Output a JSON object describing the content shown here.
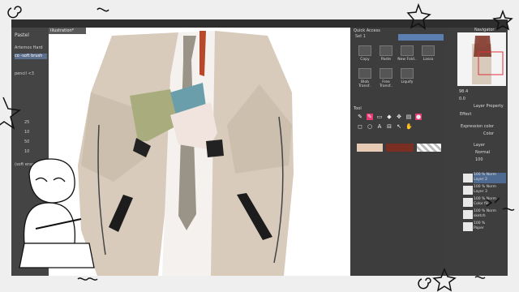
{
  "left_panel": {
    "title": "Pastel",
    "items": [
      "Artemos Hard",
      "co -soft brush",
      "pencil <3",
      "(soft eraser)"
    ],
    "numbers": [
      "25",
      "10",
      "50",
      "10"
    ]
  },
  "document": {
    "tab_label": "Illustration*"
  },
  "quick_access": {
    "header": "Quick Access",
    "set_label": "Set 1",
    "buttons": [
      "Copy",
      "Paste",
      "New Fold..",
      "Lasso",
      "Blob Transf..",
      "Free Transf..",
      "Liquify"
    ]
  },
  "tool_panel": {
    "title": "Tool"
  },
  "colors": {
    "primary": "#e8cbb5",
    "secondary": "#7a2f22",
    "pink_accent": "#e63a72"
  },
  "navigator": {
    "title": "Navigator",
    "zoom": "98.4",
    "angle": "0.0"
  },
  "layer_property": {
    "title": "Layer Property",
    "effect": "Effect",
    "expression_color": "Expression color",
    "color": "Color"
  },
  "layers": {
    "title": "Layer",
    "blend": "Normal",
    "opacity": "100",
    "items": [
      {
        "pct": "100 % Norm",
        "name": "Layer 2"
      },
      {
        "pct": "100 % Norm",
        "name": "Layer 3"
      },
      {
        "pct": "100 % Norm",
        "name": "Color fill"
      },
      {
        "pct": "100 % Norm",
        "name": "sketch"
      },
      {
        "pct": "100 %",
        "name": "Paper"
      }
    ]
  }
}
